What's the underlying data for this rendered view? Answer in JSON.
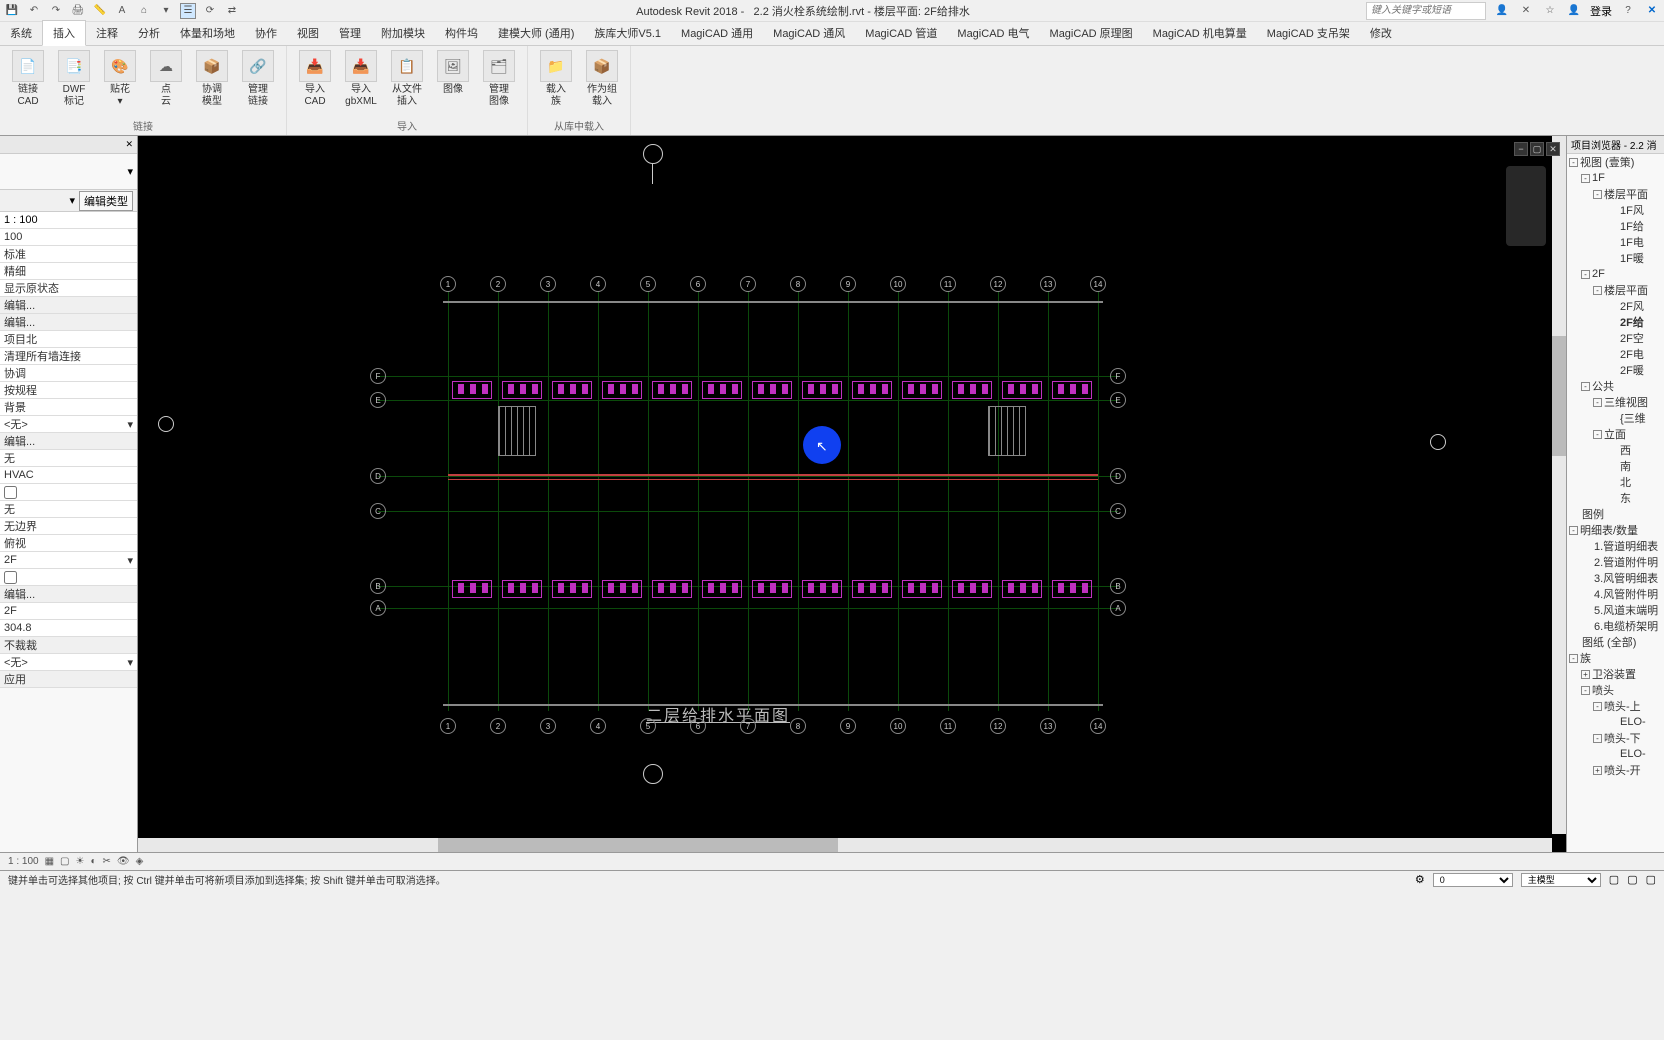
{
  "title": {
    "app": "Autodesk Revit 2018 -",
    "file": "2.2 消火栓系统绘制.rvt - 楼层平面: 2F给排水"
  },
  "search_placeholder": "键入关键字或短语",
  "login_label": "登录",
  "ribbon_tabs": [
    "系统",
    "插入",
    "注释",
    "分析",
    "体量和场地",
    "协作",
    "视图",
    "管理",
    "附加模块",
    "构件坞",
    "建模大师 (通用)",
    "族库大师V5.1",
    "MagiCAD 通用",
    "MagiCAD 通风",
    "MagiCAD 管道",
    "MagiCAD 电气",
    "MagiCAD 原理图",
    "MagiCAD 机电算量",
    "MagiCAD 支吊架",
    "修改"
  ],
  "active_tab_index": 1,
  "ribbon_groups": [
    {
      "label": "链接",
      "buttons": [
        {
          "label": "链接\nCAD",
          "icon": "📄"
        },
        {
          "label": "DWF\n标记",
          "icon": "📑"
        },
        {
          "label": "贴花\n▾",
          "icon": "🎨"
        },
        {
          "label": "点\n云",
          "icon": "☁"
        },
        {
          "label": "协调\n模型",
          "icon": "📦"
        },
        {
          "label": "管理\n链接",
          "icon": "🔗"
        }
      ]
    },
    {
      "label": "导入",
      "buttons": [
        {
          "label": "导入\nCAD",
          "icon": "📥"
        },
        {
          "label": "导入\ngbXML",
          "icon": "📥"
        },
        {
          "label": "从文件\n插入",
          "icon": "📋"
        },
        {
          "label": "图像",
          "icon": "🖼"
        },
        {
          "label": "管理\n图像",
          "icon": "🗂"
        }
      ]
    },
    {
      "label": "从库中载入",
      "buttons": [
        {
          "label": "载入\n族",
          "icon": "📁"
        },
        {
          "label": "作为组\n载入",
          "icon": "📦"
        }
      ]
    }
  ],
  "properties": {
    "edit_type": "编辑类型",
    "scale_input": "1 : 100",
    "scale_value": "100",
    "rows": [
      "标准",
      "精细",
      "显示原状态"
    ],
    "edit_btn": "编辑...",
    "project_north": "项目北",
    "clean_walls": "清理所有墙连接",
    "coord": "协调",
    "by_rule": "按规程",
    "background": "背景",
    "none": "<无>",
    "wu": "无",
    "hvac": "HVAC",
    "unbounded": "无边界",
    "perspective": "俯视",
    "level_2f": "2F",
    "height": "304.8",
    "no_crop": "不裁裁",
    "apply": "应用"
  },
  "drawing_title": "二层给排水平面图",
  "grid_numbers_top": [
    "1",
    "2",
    "3",
    "4",
    "5",
    "6",
    "7",
    "8",
    "9",
    "10",
    "11",
    "12",
    "13",
    "14"
  ],
  "grid_letters_left": [
    "F",
    "E",
    "D",
    "C",
    "B",
    "A"
  ],
  "browser": {
    "title": "项目浏览器 - 2.2 消",
    "items": [
      {
        "level": 0,
        "toggle": "-",
        "label": "视图 (壹策)"
      },
      {
        "level": 1,
        "toggle": "-",
        "label": "1F"
      },
      {
        "level": 2,
        "toggle": "-",
        "label": "楼层平面"
      },
      {
        "level": 3,
        "toggle": "",
        "label": "1F风"
      },
      {
        "level": 3,
        "toggle": "",
        "label": "1F给"
      },
      {
        "level": 3,
        "toggle": "",
        "label": "1F电"
      },
      {
        "level": 3,
        "toggle": "",
        "label": "1F暖"
      },
      {
        "level": 1,
        "toggle": "-",
        "label": "2F"
      },
      {
        "level": 2,
        "toggle": "-",
        "label": "楼层平面"
      },
      {
        "level": 3,
        "toggle": "",
        "label": "2F风"
      },
      {
        "level": 3,
        "toggle": "",
        "label": "2F给",
        "bold": true
      },
      {
        "level": 3,
        "toggle": "",
        "label": "2F空"
      },
      {
        "level": 3,
        "toggle": "",
        "label": "2F电"
      },
      {
        "level": 3,
        "toggle": "",
        "label": "2F暖"
      },
      {
        "level": 1,
        "toggle": "-",
        "label": "公共"
      },
      {
        "level": 2,
        "toggle": "-",
        "label": "三维视图"
      },
      {
        "level": 3,
        "toggle": "",
        "label": "{三维"
      },
      {
        "level": 2,
        "toggle": "-",
        "label": "立面"
      },
      {
        "level": 3,
        "toggle": "",
        "label": "西"
      },
      {
        "level": 3,
        "toggle": "",
        "label": "南"
      },
      {
        "level": 3,
        "toggle": "",
        "label": "北"
      },
      {
        "level": 3,
        "toggle": "",
        "label": "东"
      },
      {
        "level": 0,
        "toggle": "",
        "label": "图例"
      },
      {
        "level": 0,
        "toggle": "-",
        "label": "明细表/数量"
      },
      {
        "level": 1,
        "toggle": "",
        "label": "1.管道明细表"
      },
      {
        "level": 1,
        "toggle": "",
        "label": "2.管道附件明"
      },
      {
        "level": 1,
        "toggle": "",
        "label": "3.风管明细表"
      },
      {
        "level": 1,
        "toggle": "",
        "label": "4.风管附件明"
      },
      {
        "level": 1,
        "toggle": "",
        "label": "5.风道末端明"
      },
      {
        "level": 1,
        "toggle": "",
        "label": "6.电缆桥架明"
      },
      {
        "level": 0,
        "toggle": "",
        "label": "图纸 (全部)"
      },
      {
        "level": 0,
        "toggle": "-",
        "label": "族"
      },
      {
        "level": 1,
        "toggle": "+",
        "label": "卫浴装置"
      },
      {
        "level": 1,
        "toggle": "-",
        "label": "喷头"
      },
      {
        "level": 2,
        "toggle": "-",
        "label": "喷头-上"
      },
      {
        "level": 3,
        "toggle": "",
        "label": "ELO-"
      },
      {
        "level": 2,
        "toggle": "-",
        "label": "喷头-下"
      },
      {
        "level": 3,
        "toggle": "",
        "label": "ELO-"
      },
      {
        "level": 2,
        "toggle": "+",
        "label": "喷头-开"
      }
    ]
  },
  "view_bar": {
    "scale": "1 : 100"
  },
  "status": {
    "hint": "键并单击可选择其他项目; 按 Ctrl 键并单击可将新项目添加到选择集; 按 Shift 键并单击可取消选择。",
    "combo1": "0",
    "combo2": "主模型"
  }
}
